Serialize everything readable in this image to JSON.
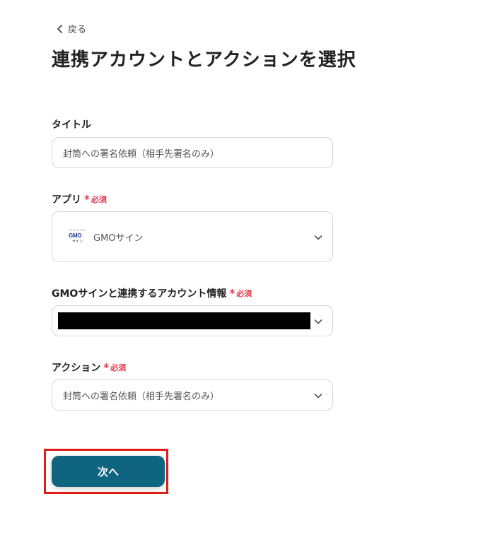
{
  "back": {
    "label": "戻る"
  },
  "page_title": "連携アカウントとアクションを選択",
  "required_label": "必須",
  "fields": {
    "title": {
      "label": "タイトル",
      "value": "封筒への署名依頼（相手先署名のみ）"
    },
    "app": {
      "label": "アプリ",
      "value": "GMOサイン",
      "logo_text": "GMO",
      "logo_subtext": "サイン"
    },
    "account": {
      "label": "GMOサインと連携するアカウント情報",
      "value": ""
    },
    "action": {
      "label": "アクション",
      "value": "封筒への署名依頼（相手先署名のみ）"
    }
  },
  "next_button": {
    "label": "次へ"
  },
  "colors": {
    "primary": "#0f6480",
    "required": "#e2394b",
    "highlight": "#e21b1b",
    "border": "#d3d7dc"
  }
}
